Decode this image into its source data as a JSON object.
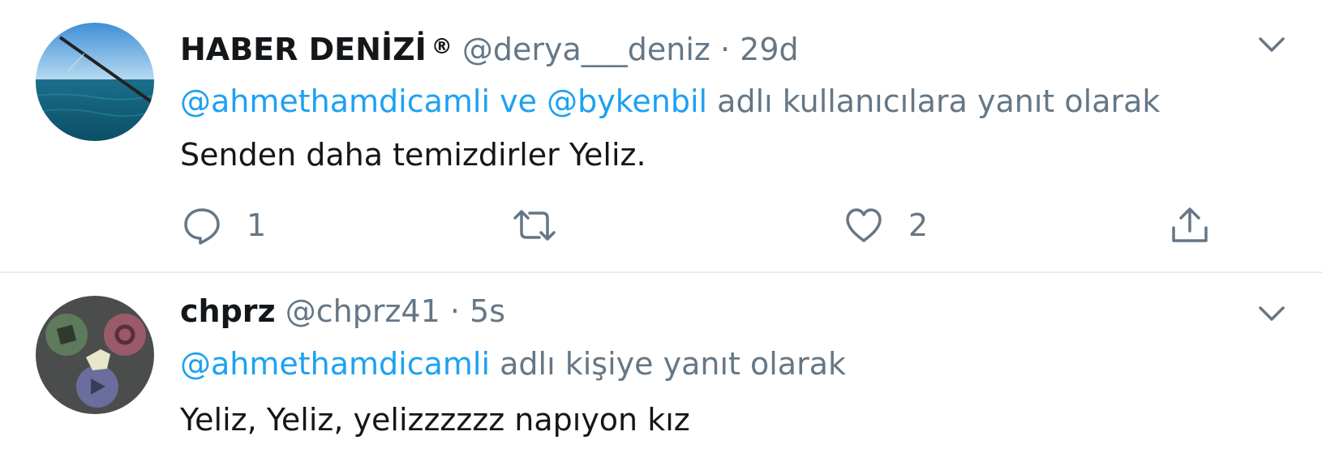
{
  "tweets": [
    {
      "display_name": "HABER DENİZİ",
      "badge": "®",
      "handle": "@derya___deniz",
      "separator": "·",
      "time": "29d",
      "reply_mentions": [
        "@ahmethamdicamli",
        "ve",
        "@bykenbil"
      ],
      "reply_suffix": "adlı kullanıcılara yanıt olarak",
      "text": "Senden daha temizdirler Yeliz.",
      "actions": {
        "reply_count": "1",
        "retweet_count": "",
        "like_count": "2"
      },
      "avatar_icon": "fishing-rod-sea-avatar"
    },
    {
      "display_name": "chprz",
      "handle": "@chprz41",
      "separator": "·",
      "time": "5s",
      "reply_mentions": [
        "@ahmethamdicamli"
      ],
      "reply_suffix": "adlı kişiye yanıt olarak",
      "text": "Yeliz, Yeliz, yelizzzzzz napıyon kız",
      "avatar_icon": "controller-buttons-avatar"
    }
  ],
  "colors": {
    "link": "#1da1f2",
    "muted": "#657786",
    "text": "#14171a",
    "divider": "#e6ecf0"
  },
  "icons": {
    "caret": "chevron-down-icon",
    "reply": "comment-bubble-icon",
    "retweet": "retweet-icon",
    "like": "heart-icon",
    "share": "share-upload-icon"
  }
}
